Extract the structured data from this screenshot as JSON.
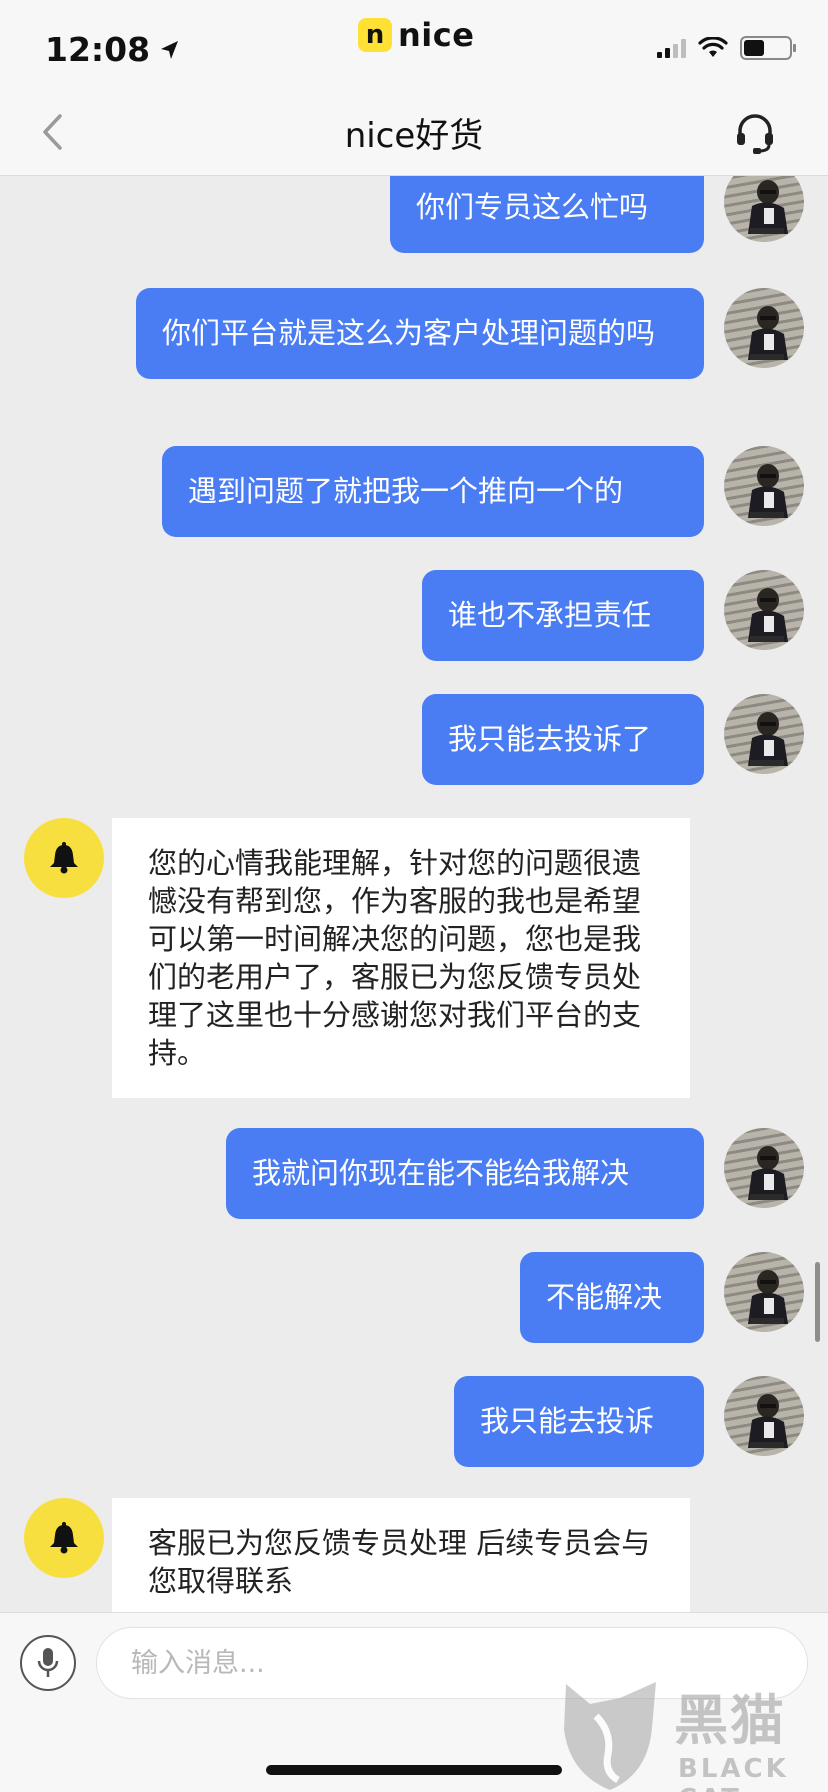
{
  "status_bar": {
    "time": "12:08",
    "brand_mark": "n",
    "brand_name": "nice",
    "battery_level": 0.45
  },
  "nav": {
    "title": "nice好货",
    "back_icon": "chevron-left-icon",
    "support_icon": "headset-icon"
  },
  "messages": [
    {
      "side": "out",
      "text": "你们专员这么忙吗"
    },
    {
      "side": "out",
      "text": "你们平台就是这么为客户处理问题的吗"
    },
    {
      "side": "out",
      "text": "遇到问题了就把我一个推向一个的"
    },
    {
      "side": "out",
      "text": "谁也不承担责任"
    },
    {
      "side": "out",
      "text": "我只能去投诉了"
    },
    {
      "side": "in",
      "text": "您的心情我能理解，针对您的问题很遗憾没有帮到您，作为客服的我也是希望可以第一时间解决您的问题，您也是我们的老用户了，客服已为您反馈专员处理了这里也十分感谢您对我们平台的支持。"
    },
    {
      "side": "out",
      "text": "我就问你现在能不能给我解决"
    },
    {
      "side": "out",
      "text": "不能解决"
    },
    {
      "side": "out",
      "text": "我只能去投诉"
    },
    {
      "side": "in",
      "text": "客服已为您反馈专员处理 后续专员会与您取得联系"
    }
  ],
  "input": {
    "placeholder": "输入消息..."
  },
  "watermark": {
    "text": "黑猫",
    "sub": "BLACK CAT"
  },
  "colors": {
    "outgoing_bubble": "#4a7cf3",
    "bot_avatar": "#f7df3f",
    "brand": "#ffe135"
  }
}
